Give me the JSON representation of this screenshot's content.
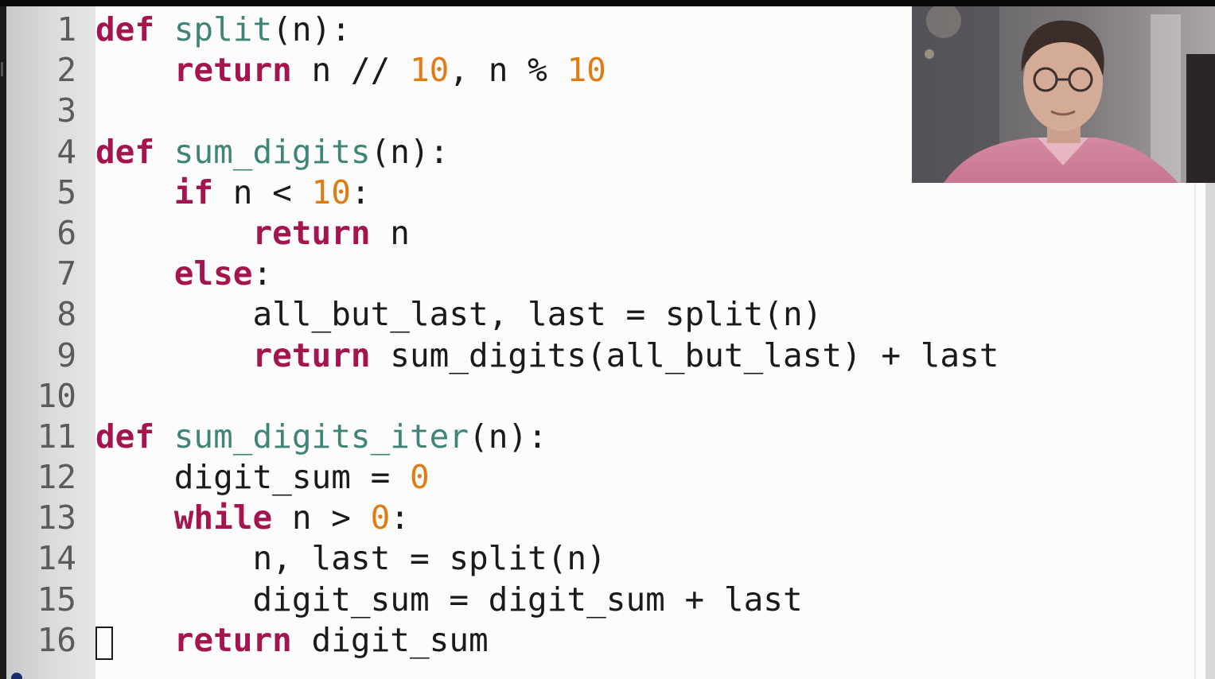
{
  "editor": {
    "lines": [
      {
        "n": "1",
        "parts": [
          {
            "t": "def",
            "c": "kw"
          },
          {
            "t": " "
          },
          {
            "t": "split",
            "c": "fn"
          },
          {
            "t": "(n):"
          }
        ]
      },
      {
        "n": "2",
        "parts": [
          {
            "t": "    "
          },
          {
            "t": "return",
            "c": "kw"
          },
          {
            "t": " n // "
          },
          {
            "t": "10",
            "c": "num"
          },
          {
            "t": ", n % "
          },
          {
            "t": "10",
            "c": "num"
          }
        ]
      },
      {
        "n": "3",
        "parts": []
      },
      {
        "n": "4",
        "parts": [
          {
            "t": "def",
            "c": "kw"
          },
          {
            "t": " "
          },
          {
            "t": "sum_digits",
            "c": "fn"
          },
          {
            "t": "(n):"
          }
        ]
      },
      {
        "n": "5",
        "parts": [
          {
            "t": "    "
          },
          {
            "t": "if",
            "c": "kw"
          },
          {
            "t": " n < "
          },
          {
            "t": "10",
            "c": "num"
          },
          {
            "t": ":"
          }
        ]
      },
      {
        "n": "6",
        "parts": [
          {
            "t": "        "
          },
          {
            "t": "return",
            "c": "kw"
          },
          {
            "t": " n"
          }
        ]
      },
      {
        "n": "7",
        "parts": [
          {
            "t": "    "
          },
          {
            "t": "else",
            "c": "kw"
          },
          {
            "t": ":"
          }
        ]
      },
      {
        "n": "8",
        "parts": [
          {
            "t": "        all_but_last, last = split(n)"
          }
        ]
      },
      {
        "n": "9",
        "parts": [
          {
            "t": "        "
          },
          {
            "t": "return",
            "c": "kw"
          },
          {
            "t": " sum_digits(all_but_last) + last"
          }
        ]
      },
      {
        "n": "10",
        "parts": []
      },
      {
        "n": "11",
        "parts": [
          {
            "t": "def",
            "c": "kw"
          },
          {
            "t": " "
          },
          {
            "t": "sum_digits_iter",
            "c": "fn"
          },
          {
            "t": "(n):"
          }
        ]
      },
      {
        "n": "12",
        "parts": [
          {
            "t": "    digit_sum = "
          },
          {
            "t": "0",
            "c": "num"
          }
        ]
      },
      {
        "n": "13",
        "parts": [
          {
            "t": "    "
          },
          {
            "t": "while",
            "c": "kw"
          },
          {
            "t": " n > "
          },
          {
            "t": "0",
            "c": "num"
          },
          {
            "t": ":"
          }
        ]
      },
      {
        "n": "14",
        "parts": [
          {
            "t": "        n, last = split(n)"
          }
        ]
      },
      {
        "n": "15",
        "parts": [
          {
            "t": "        digit_sum = digit_sum + last"
          }
        ]
      },
      {
        "n": "16",
        "parts": [
          {
            "t": "    "
          },
          {
            "t": "return",
            "c": "kw"
          },
          {
            "t": " digit_sum"
          }
        ],
        "cursor": true
      }
    ]
  },
  "colors": {
    "keyword": "#a4144e",
    "function_name": "#3f8476",
    "number": "#e07c14",
    "text": "#1a1a1a",
    "line_number": "#5b5b5b"
  }
}
